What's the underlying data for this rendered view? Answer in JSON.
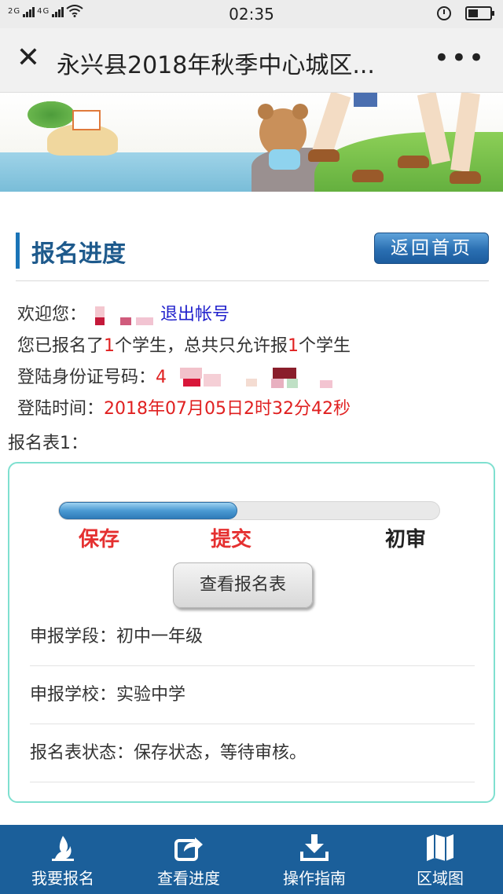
{
  "status_bar": {
    "network_left": "2G",
    "network_right": "4G",
    "time": "02:35"
  },
  "title_bar": {
    "close_symbol": "✕",
    "title": "永兴县2018年秋季中心城区...",
    "more_symbol": "•••"
  },
  "section": {
    "title": "报名进度",
    "home_button": "返回首页"
  },
  "user": {
    "welcome_label": "欢迎您：",
    "logout_link": "退出帐号",
    "count_prefix": "您已报名了",
    "count_registered": "1",
    "count_middle": "个学生，总共只允许报",
    "count_allowed": "1",
    "count_suffix": "个学生",
    "id_label": "登陆身份证号码：",
    "id_visible_prefix": "4",
    "login_time_label": "登陆时间：",
    "login_time": "2018年07月05日2时32分42秒"
  },
  "form": {
    "label": "报名表1：",
    "progress": {
      "fraction_complete": 0.47,
      "steps": [
        "保存",
        "提交",
        "初审"
      ],
      "step_colors": [
        "#e53030",
        "#e53030",
        "#222222"
      ]
    },
    "view_button": "查看报名表",
    "rows": [
      {
        "label": "申报学段：",
        "value": "初中一年级"
      },
      {
        "label": "申报学校：",
        "value": "实验中学"
      },
      {
        "label": "报名表状态：",
        "value": "保存状态，等待审核。"
      }
    ]
  },
  "bottom_nav": [
    {
      "label": "我要报名",
      "icon": "flame-icon"
    },
    {
      "label": "查看进度",
      "icon": "share-icon"
    },
    {
      "label": "操作指南",
      "icon": "download-icon"
    },
    {
      "label": "区域图",
      "icon": "map-icon"
    }
  ],
  "colors": {
    "brand_blue": "#1b5f9a",
    "accent_red": "#e02020",
    "card_border": "#7fe0d0",
    "link_blue": "#2222cc"
  }
}
